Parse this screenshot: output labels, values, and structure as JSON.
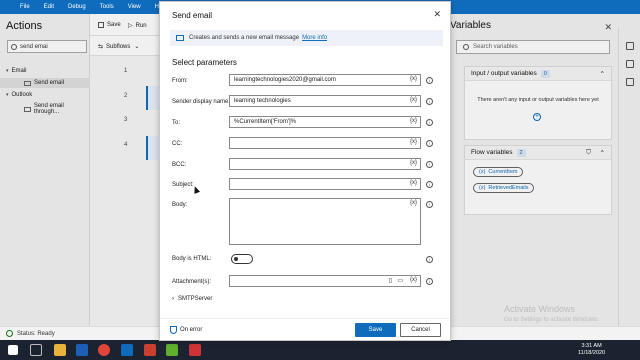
{
  "menu": [
    "File",
    "Edit",
    "Debug",
    "Tools",
    "View",
    "Help"
  ],
  "actions_pane": {
    "title": "Actions",
    "search_value": "send emai",
    "tree": [
      {
        "label": "Email",
        "level": 0
      },
      {
        "label": "Send email",
        "level": 1
      },
      {
        "label": "Outlook",
        "level": 0
      },
      {
        "label": "Send email through...",
        "level": 1
      }
    ]
  },
  "toolbar": {
    "save_label": "Save",
    "run_label": "Run",
    "subflows_label": "Subflows"
  },
  "canvas": {
    "line_numbers": [
      "1",
      "2",
      "3",
      "4"
    ]
  },
  "variables_pane": {
    "title": "Variables",
    "search_placeholder": "Search variables",
    "io_section": {
      "title": "Input / output variables",
      "count": "0",
      "empty_text": "There aren't any input or output variables here yet"
    },
    "flow_section": {
      "title": "Flow variables",
      "count": "2",
      "items": [
        "CurrentItem",
        "RetrievedEmails"
      ]
    }
  },
  "dialog": {
    "title": "Send email",
    "info_text": "Creates and sends a new email message",
    "info_link": "More info",
    "section_title": "Select parameters",
    "fields": {
      "from": {
        "label": "From:",
        "value": "learningtechnologies2020@gmail.com"
      },
      "sender_display_name": {
        "label": "Sender display name:",
        "value": "learning technologies"
      },
      "to": {
        "label": "To:",
        "value": "%CurrentItem['From']%"
      },
      "cc": {
        "label": "CC:",
        "value": ""
      },
      "bcc": {
        "label": "BCC:",
        "value": ""
      },
      "subject": {
        "label": "Subject:",
        "value": ""
      },
      "body": {
        "label": "Body:",
        "value": ""
      },
      "body_is_html": {
        "label": "Body is HTML:"
      },
      "attachments": {
        "label": "Attachment(s):",
        "value": ""
      }
    },
    "var_marker": "{x}",
    "smtp_label": "SMTPServer",
    "on_error_label": "On error",
    "save_label": "Save",
    "cancel_label": "Cancel"
  },
  "status_bar": {
    "text": "Status: Ready"
  },
  "watermark": {
    "line1": "Activate Windows",
    "line2": "Go to Settings to activate Windows."
  },
  "taskbar": {
    "time": "3:31 AM",
    "date": "11/18/2020"
  },
  "colors": {
    "accent": "#0f6cbd",
    "taskbar": "#1c2330"
  }
}
